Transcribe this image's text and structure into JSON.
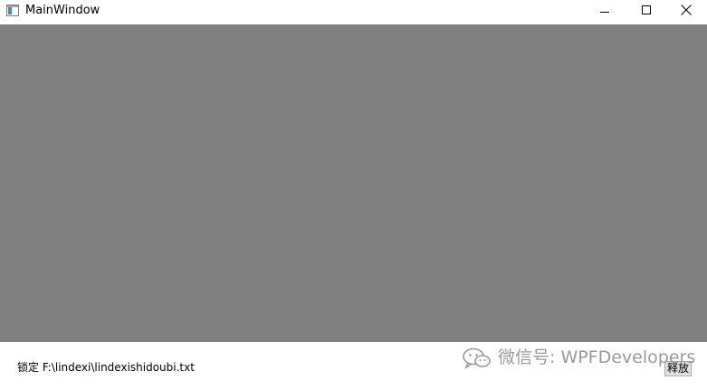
{
  "window": {
    "title": "MainWindow",
    "app_icon": "window-app-icon",
    "controls": {
      "minimize_icon": "minimize-icon",
      "maximize_icon": "maximize-icon",
      "close_icon": "close-icon"
    }
  },
  "content": {
    "background_color": "#808080"
  },
  "footer": {
    "status_text": "锁定 F:\\lindexi\\lindexishidoubi.txt",
    "release_button_label": "释放"
  },
  "watermark": {
    "icon": "wechat-icon",
    "text": "微信号: WPFDevelopers"
  }
}
